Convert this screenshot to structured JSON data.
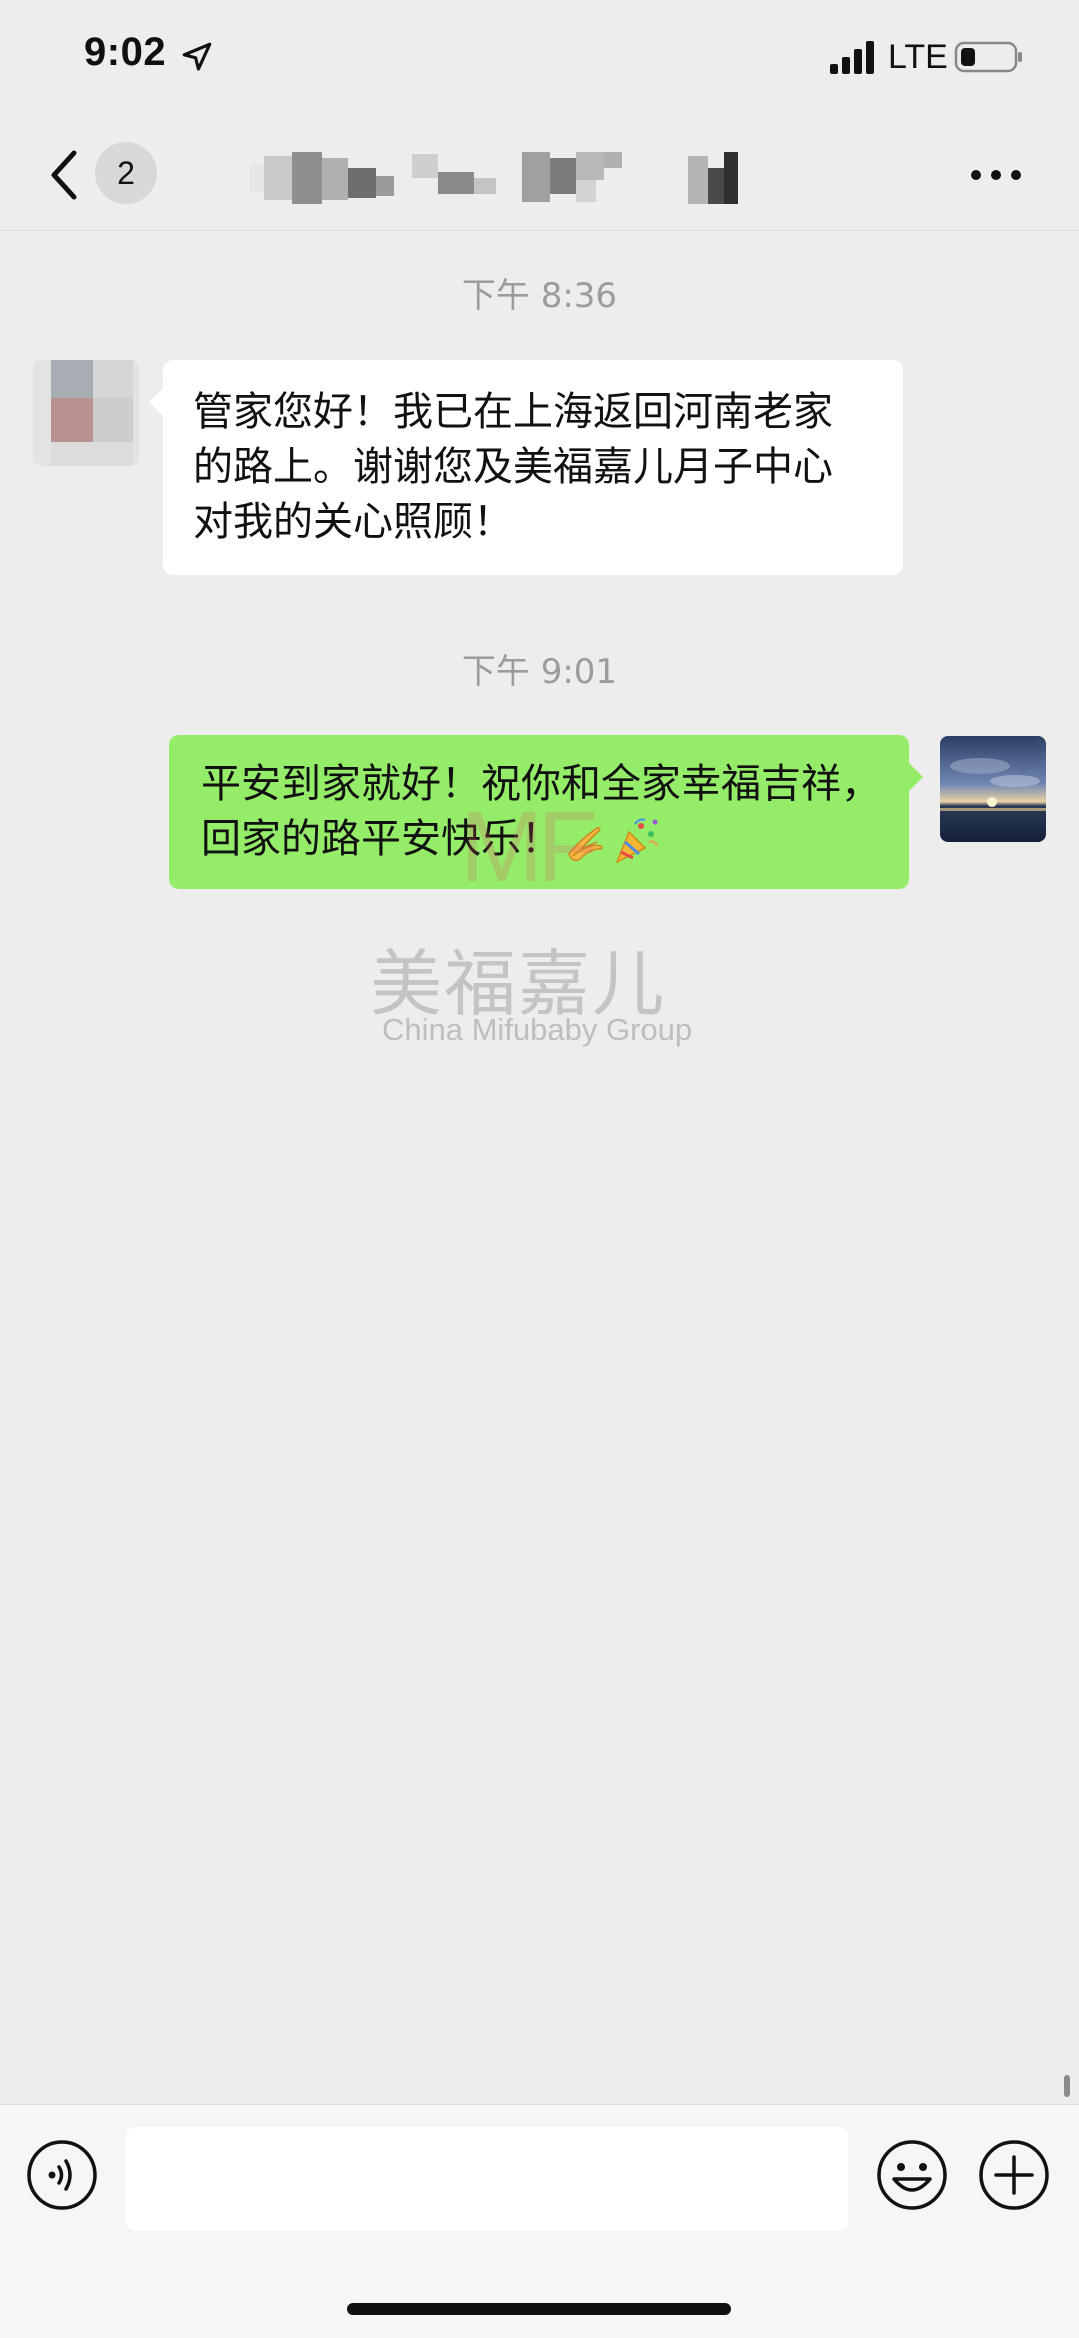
{
  "status_bar": {
    "time": "9:02",
    "network": "LTE"
  },
  "nav": {
    "unread_count": "2"
  },
  "messages": [
    {
      "timestamp": "下午 8:36",
      "direction": "incoming",
      "text": "管家您好！我已在上海返回河南老家的路上。谢谢您及美福嘉儿月子中心对我的关心照顾！"
    },
    {
      "timestamp": "下午 9:01",
      "direction": "outgoing",
      "text": "平安到家就好！祝你和全家幸福吉祥，回家的路平安快乐！",
      "emojis": [
        "clapping-hands-emoji",
        "party-popper-emoji"
      ]
    }
  ],
  "watermark": {
    "mark": "MF",
    "name_cn": "美福嘉儿",
    "name_en": "China Mifubaby Group"
  },
  "input": {
    "value": ""
  },
  "colors": {
    "background": "#ededed",
    "outgoing_bubble": "#95ec69",
    "incoming_bubble": "#ffffff",
    "timestamp_text": "#9c9c9c"
  },
  "icons": [
    "location-arrow-icon",
    "signal-icon",
    "battery-icon",
    "back-chevron-icon",
    "more-icon",
    "voice-icon",
    "emoji-icon",
    "plus-icon"
  ]
}
